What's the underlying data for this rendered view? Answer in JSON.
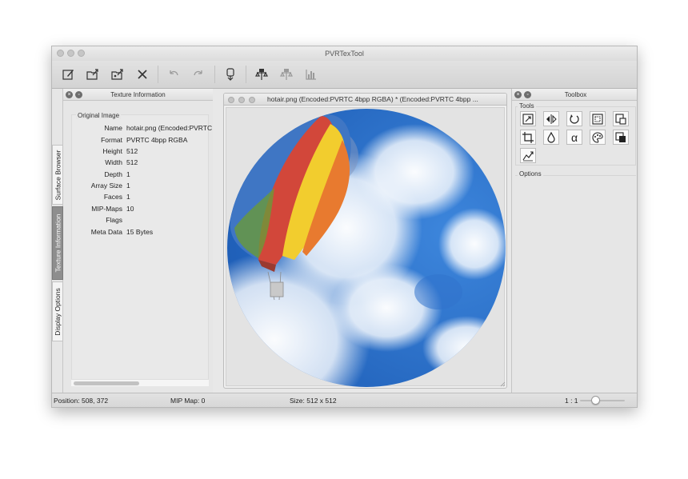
{
  "window": {
    "title": "PVRTexTool"
  },
  "side_tabs": [
    {
      "label": "Surface Browser",
      "active": false
    },
    {
      "label": "Texture Information",
      "active": true
    },
    {
      "label": "Display Options",
      "active": false
    }
  ],
  "texture_info": {
    "panel_title": "Texture Information",
    "group_title": "Original Image",
    "rows": [
      {
        "key": "Name",
        "value": "hotair.png (Encoded:PVRTC 4"
      },
      {
        "key": "Format",
        "value": "PVRTC 4bpp RGBA"
      },
      {
        "key": "Height",
        "value": "512"
      },
      {
        "key": "Width",
        "value": "512"
      },
      {
        "key": "Depth",
        "value": "1"
      },
      {
        "key": "Array Size",
        "value": "1"
      },
      {
        "key": "Faces",
        "value": "1"
      },
      {
        "key": "MIP-Maps",
        "value": "10"
      },
      {
        "key": "Flags",
        "value": ""
      },
      {
        "key": "Meta Data",
        "value": "15 Bytes"
      }
    ]
  },
  "viewer": {
    "title": "hotair.png (Encoded:PVRTC 4bpp RGBA) * (Encoded:PVRTC 4bpp ..."
  },
  "toolbox": {
    "panel_title": "Toolbox",
    "tools_label": "Tools",
    "options_label": "Options",
    "alpha_glyph": "α"
  },
  "status": {
    "position": "Position: 508, 372",
    "mip_map": "MIP Map: 0",
    "size": "Size: 512 x 512",
    "zoom": "1 : 1"
  },
  "icons": {
    "toolbar": [
      "new-icon",
      "open-icon",
      "open-special-icon",
      "close-icon",
      "undo-icon",
      "redo-icon",
      "encode-icon",
      "compare-icon",
      "compare-alt-icon",
      "histogram-icon"
    ],
    "tools": [
      "resize-icon",
      "flip-icon",
      "rotate-icon",
      "border-icon",
      "copy-surface-icon",
      "crop-icon",
      "colour-icon",
      "alpha-icon",
      "palette-icon",
      "premultiply-icon",
      "normal-map-icon"
    ]
  },
  "colors": {
    "sky_blue": "#2f78d4",
    "cloud_white": "#eef4fb",
    "balloon_yellow": "#f2cd2e",
    "balloon_red": "#d2473a",
    "balloon_blue": "#3f76c4"
  }
}
